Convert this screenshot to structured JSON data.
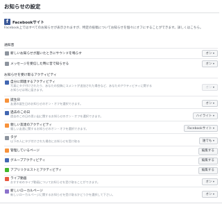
{
  "page": {
    "title": "お知らせの設定"
  },
  "facebook": {
    "title": "Facebookサイト",
    "description": "Facebook上ではすべてのお知らせが表示されますが、特定の投稿についてお知らせを個々にオフにすることができます。詳しくはこちら。"
  },
  "sections": {
    "notifications": "通知音",
    "activities": "お知らせを受け取るアクティビティ"
  },
  "sound_rows": [
    {
      "label": "新しいお知らせが届いたときにサウンドを鳴らす",
      "button": "オン"
    },
    {
      "label": "メッセージを受信した時に音で知らせる",
      "button": "オン"
    }
  ],
  "activity_rows": [
    {
      "label": "自分に関連するアクティビティ",
      "sub": "写真にタグ付けされたり、あなたの投稿にコメントが追加された場合など、あなたのアクティビティに関する",
      "sub2": "お知らせは常に届きます。",
      "button": "オン",
      "disabled": true
    },
    {
      "label": "誕生日",
      "sub": "友達の誕生日のお知らせのオン・オフを選択できます。",
      "button": "オン"
    },
    {
      "label": "過去のこの日",
      "sub": "過去のこの日の思い出に関するお知らせのオン・オフを選択できます。",
      "button": "ハイライト"
    },
    {
      "label": "親しい友達のアクティビティ",
      "sub": "親しい友達に関するお知らせのオン・オフを選択できます。",
      "button": "Facebookサイト"
    },
    {
      "label": "タグ",
      "sub": "以下の人にタグ付けされた場合にお知らせを受け取る",
      "button": "誰でも"
    },
    {
      "label": "管理しているページ",
      "button": "編集する"
    },
    {
      "label": "グループアクティビティ",
      "button": "編集する"
    },
    {
      "label": "アプリリクエストとアクティビティ",
      "button": "編集する"
    },
    {
      "label": "ライブ動画",
      "sub": "おすすめのライブ動画についてお知らせを受け取ることができます。",
      "button": "オン"
    },
    {
      "label": "新しいローカルページ",
      "sub": "新しいローカルページに関するお知らせを受け取るかどうかを選択して下さい。",
      "button": "オン"
    }
  ],
  "colors": {
    "facebook_blue": "#3b5998",
    "button_bg": "#f5f6f7"
  }
}
